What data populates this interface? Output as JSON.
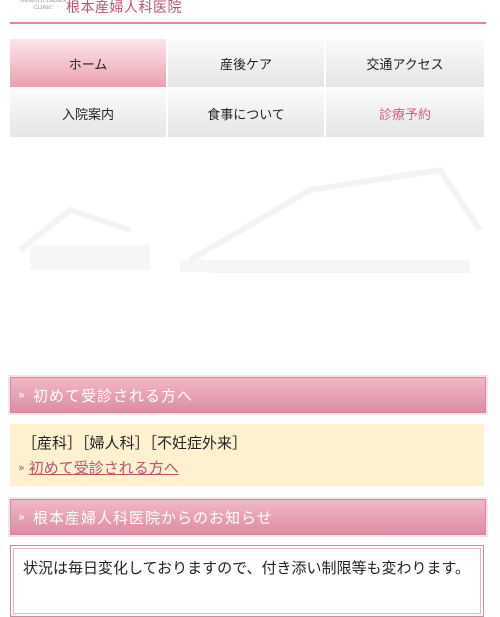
{
  "header": {
    "logo_text": "NEMOTO LADIES CLINIC",
    "site_name": "根本産婦人科医院"
  },
  "nav": {
    "row1": [
      {
        "label": "ホーム"
      },
      {
        "label": "産後ケア"
      },
      {
        "label": "交通アクセス"
      }
    ],
    "row2": [
      {
        "label": "入院案内"
      },
      {
        "label": "食事について"
      },
      {
        "label": "診療予約"
      }
    ]
  },
  "section1": {
    "title": "初めて受診される方へ",
    "departments": "［産科］［婦人科］［不妊症外来］",
    "link": "初めて受診される方へ"
  },
  "section2": {
    "title": "根本産婦人科医院からのお知らせ",
    "notice": "状況は毎日変化しておりますので、付き添い制限等も変わります。"
  },
  "colors": {
    "accent": "#c0526f",
    "bar_gradient_top": "#f2b8c6",
    "bar_gradient_bottom": "#dd8ca2",
    "info_bg": "#fdf1d0"
  }
}
